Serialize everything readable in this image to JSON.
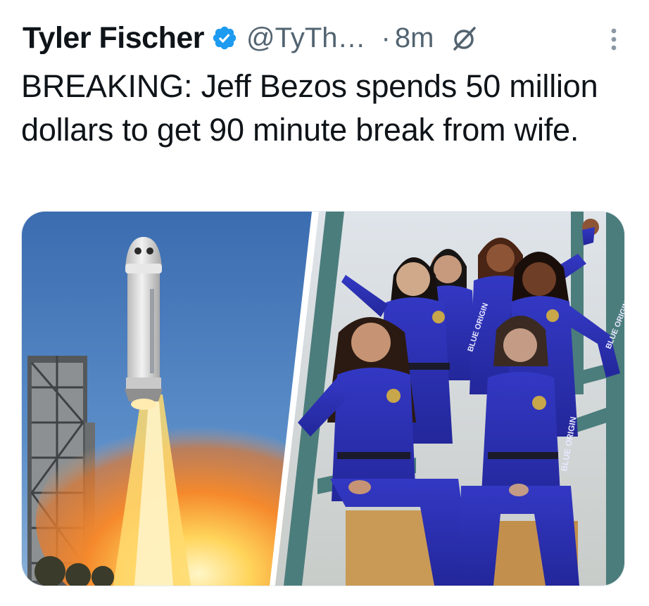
{
  "author": {
    "display_name": "Tyler Fischer",
    "handle": "@TyTh…",
    "separator": "·",
    "time_ago": "8m",
    "verified": true,
    "verified_color": "#1d9bf0"
  },
  "tweet": {
    "text": "BREAKING: Jeff Bezos spends 50 million dollars to get 90 minute break from wife."
  },
  "media": {
    "left_image": "rocket-launch-photo",
    "right_image": "crew-group-photo",
    "suit_text": [
      "BLUE ORIGIN",
      "BLUE ORIGIN",
      "BLUE ORIGIN"
    ]
  },
  "icons": {
    "verified": "verified-badge-icon",
    "grok": "grok-icon",
    "more": "more-vertical-icon"
  },
  "colors": {
    "text": "#0f1419",
    "secondary": "#536471",
    "suit_blue": "#2b2fb5",
    "sky": "#3f6fae"
  }
}
